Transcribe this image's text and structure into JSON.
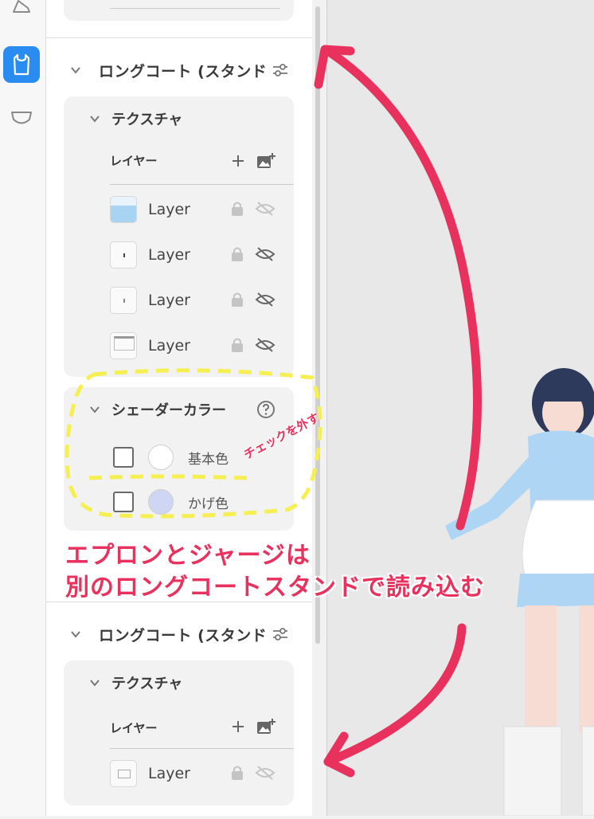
{
  "sections": [
    {
      "title": "ロングコート (スタンド",
      "texture": {
        "title": "テクスチャ",
        "layers_label": "レイヤー",
        "layers": [
          {
            "name": "Layer"
          },
          {
            "name": "Layer"
          },
          {
            "name": "Layer"
          },
          {
            "name": "Layer"
          }
        ]
      },
      "shader": {
        "title": "シェーダーカラー",
        "rows": [
          {
            "label": "基本色",
            "color": "#ffffff"
          },
          {
            "label": "かげ色",
            "color": "#cfd6f4"
          }
        ]
      }
    },
    {
      "title": "ロングコート (スタンド",
      "texture": {
        "title": "テクスチャ",
        "layers_label": "レイヤー",
        "layers": [
          {
            "name": "Layer"
          }
        ]
      }
    }
  ],
  "annotations": {
    "uncheck": "チェックを外す",
    "line1": "エプロンとジャージは",
    "line2": "別のロングコートスタンドで読み込む"
  },
  "colors": {
    "accent": "#2a8cf0",
    "annotation": "#e8315d",
    "highlight": "#f5ef52"
  },
  "icons": {
    "rail": [
      "shoe-icon",
      "top-icon",
      "bottom-icon"
    ],
    "section": [
      "chevron-down-icon",
      "settings-sliders-icon"
    ],
    "layer": [
      "lock-icon",
      "eye-off-icon"
    ],
    "add": [
      "plus-icon",
      "add-image-icon"
    ],
    "help": "help-circle-icon"
  }
}
